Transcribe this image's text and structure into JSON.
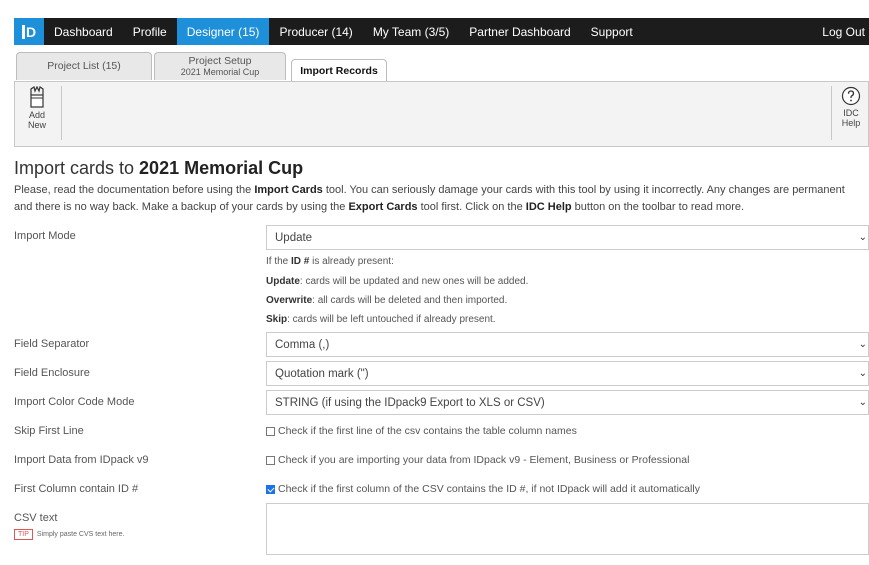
{
  "nav": {
    "logo": "ID",
    "items": [
      "Dashboard",
      "Profile",
      "Designer (15)",
      "Producer (14)",
      "My Team (3/5)",
      "Partner Dashboard",
      "Support"
    ],
    "logout": "Log Out"
  },
  "tabs": {
    "project_list": "Project List (15)",
    "project_setup": "Project Setup",
    "project_setup_sub": "2021 Memorial Cup",
    "import_records": "Import Records"
  },
  "toolbar": {
    "add_line1": "Add",
    "add_line2": "New",
    "help_line1": "IDC",
    "help_line2": "Help"
  },
  "heading": {
    "prefix": "Import cards to ",
    "project": "2021 Memorial Cup"
  },
  "intro": {
    "p1": "Please, read the documentation before using the ",
    "b1": "Import Cards",
    "p2": " tool. You can seriously damage your cards with this tool by using it incorrectly. Any changes are permanent and there is no way back. Make a backup of your cards by using the ",
    "b2": "Export Cards",
    "p3": " tool first. Click on the ",
    "b3": "IDC Help",
    "p4": " button on the toolbar to read more."
  },
  "form": {
    "import_mode": {
      "label": "Import Mode",
      "value": "Update"
    },
    "mode_help": {
      "h1a": "If the ",
      "h1b": "ID #",
      "h1c": " is already present:",
      "h2a": "Update",
      "h2b": ": cards will be updated and new ones will be added.",
      "h3a": "Overwrite",
      "h3b": ": all cards will be deleted and then imported.",
      "h4a": "Skip",
      "h4b": ": cards will be left untouched if already present."
    },
    "field_separator": {
      "label": "Field Separator",
      "value": "Comma (,)"
    },
    "field_enclosure": {
      "label": "Field Enclosure",
      "value": "Quotation mark (\")"
    },
    "color_mode": {
      "label": "Import Color Code Mode",
      "value": "STRING (if using the IDpack9 Export to XLS or CSV)"
    },
    "skip_first": {
      "label": "Skip First Line",
      "text": "Check if the first line of the csv contains the table column names",
      "checked": false
    },
    "import_v9": {
      "label": "Import Data from IDpack v9",
      "text": "Check if you are importing your data from IDpack v9 - Element, Business or Professional",
      "checked": false
    },
    "first_col": {
      "label": "First Column contain ID #",
      "text": "Check if the first column of the CSV contains the ID #, if not IDpack will add it automatically",
      "checked": true
    },
    "csv": {
      "label": "CSV text",
      "tip_badge": "TIP",
      "tip_text": "Simply paste CVS text here."
    }
  }
}
